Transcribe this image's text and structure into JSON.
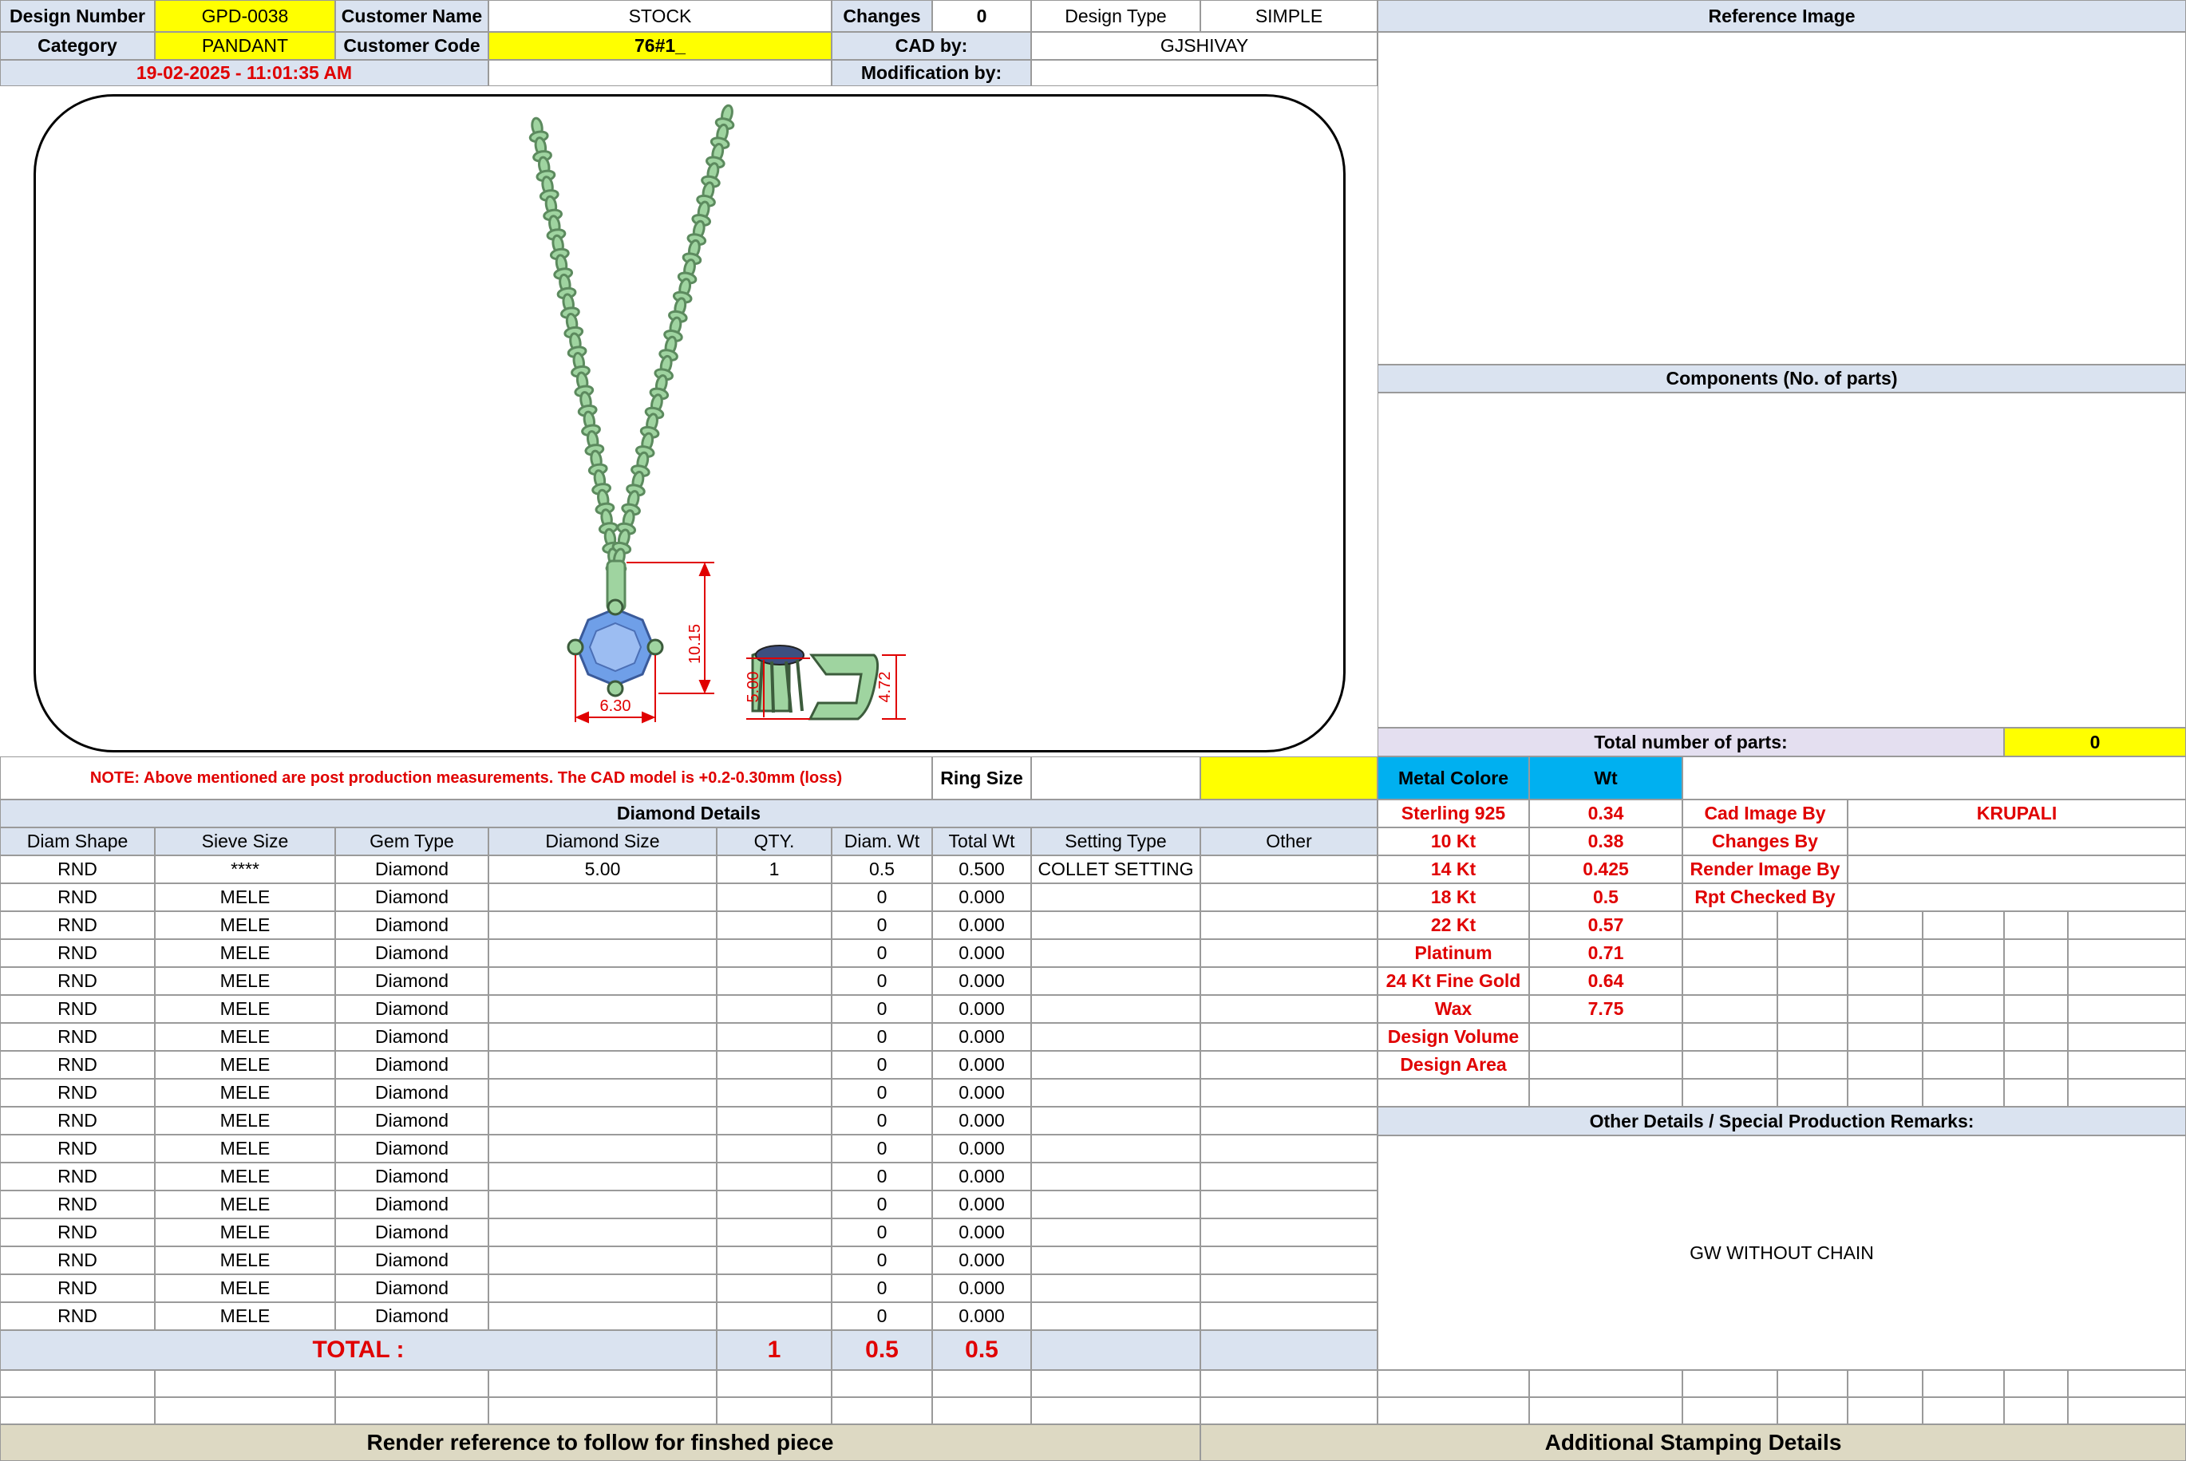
{
  "header": {
    "design_number_label": "Design Number",
    "design_number": "GPD-0038",
    "customer_name_label": "Customer Name",
    "customer_name": "STOCK",
    "changes_label": "Changes",
    "changes": "0",
    "design_type_label": "Design Type",
    "design_type": "SIMPLE",
    "reference_image_label": "Reference Image",
    "category_label": "Category",
    "category": "PANDANT",
    "customer_code_label": "Customer Code",
    "customer_code": "76#1_",
    "cad_by_label": "CAD by:",
    "cad_by": "GJSHIVAY",
    "timestamp": "19-02-2025 - 11:01:35 AM",
    "modification_by_label": "Modification by:"
  },
  "drawing": {
    "dims": [
      "10.15",
      "6.30",
      "5.00",
      "4.72"
    ]
  },
  "components_label": "Components (No. of parts)",
  "total_parts_label": "Total number of parts:",
  "total_parts": "0",
  "note": "NOTE: Above mentioned are post production measurements. The CAD model is +0.2-0.30mm (loss)",
  "ring_size_label": "Ring Size",
  "diamond": {
    "section_label": "Diamond Details",
    "columns": [
      "Diam Shape",
      "Sieve Size",
      "Gem Type",
      "Diamond Size",
      "QTY.",
      "Diam. Wt",
      "Total Wt",
      "Setting Type",
      "Other"
    ],
    "rows": [
      [
        "RND",
        "****",
        "Diamond",
        "5.00",
        "1",
        "0.5",
        "0.500",
        "COLLET SETTING",
        ""
      ],
      [
        "RND",
        "MELE",
        "Diamond",
        "",
        "",
        "0",
        "0.000",
        "",
        ""
      ],
      [
        "RND",
        "MELE",
        "Diamond",
        "",
        "",
        "0",
        "0.000",
        "",
        ""
      ],
      [
        "RND",
        "MELE",
        "Diamond",
        "",
        "",
        "0",
        "0.000",
        "",
        ""
      ],
      [
        "RND",
        "MELE",
        "Diamond",
        "",
        "",
        "0",
        "0.000",
        "",
        ""
      ],
      [
        "RND",
        "MELE",
        "Diamond",
        "",
        "",
        "0",
        "0.000",
        "",
        ""
      ],
      [
        "RND",
        "MELE",
        "Diamond",
        "",
        "",
        "0",
        "0.000",
        "",
        ""
      ],
      [
        "RND",
        "MELE",
        "Diamond",
        "",
        "",
        "0",
        "0.000",
        "",
        ""
      ],
      [
        "RND",
        "MELE",
        "Diamond",
        "",
        "",
        "0",
        "0.000",
        "",
        ""
      ],
      [
        "RND",
        "MELE",
        "Diamond",
        "",
        "",
        "0",
        "0.000",
        "",
        ""
      ],
      [
        "RND",
        "MELE",
        "Diamond",
        "",
        "",
        "0",
        "0.000",
        "",
        ""
      ],
      [
        "RND",
        "MELE",
        "Diamond",
        "",
        "",
        "0",
        "0.000",
        "",
        ""
      ],
      [
        "RND",
        "MELE",
        "Diamond",
        "",
        "",
        "0",
        "0.000",
        "",
        ""
      ],
      [
        "RND",
        "MELE",
        "Diamond",
        "",
        "",
        "0",
        "0.000",
        "",
        ""
      ],
      [
        "RND",
        "MELE",
        "Diamond",
        "",
        "",
        "0",
        "0.000",
        "",
        ""
      ],
      [
        "RND",
        "MELE",
        "Diamond",
        "",
        "",
        "0",
        "0.000",
        "",
        ""
      ],
      [
        "RND",
        "MELE",
        "Diamond",
        "",
        "",
        "0",
        "0.000",
        "",
        ""
      ]
    ],
    "total_label": "TOTAL :",
    "total_qty": "1",
    "total_diam_wt": "0.5",
    "total_wt": "0.5"
  },
  "metal": {
    "col_label": "Metal Colore",
    "wt_label": "Wt",
    "rows": [
      [
        "Sterling 925",
        "0.34"
      ],
      [
        "10 Kt",
        "0.38"
      ],
      [
        "14 Kt",
        "0.425"
      ],
      [
        "18 Kt",
        "0.5"
      ],
      [
        "22 Kt",
        "0.57"
      ],
      [
        "Platinum",
        "0.71"
      ],
      [
        "24 Kt Fine Gold",
        "0.64"
      ],
      [
        "Wax",
        "7.75"
      ],
      [
        "Design Volume",
        ""
      ],
      [
        "Design Area",
        ""
      ]
    ]
  },
  "credits": [
    [
      "Cad Image By",
      "KRUPALI"
    ],
    [
      "Changes By",
      ""
    ],
    [
      "Render Image By",
      ""
    ],
    [
      "Rpt Checked By",
      ""
    ]
  ],
  "other_details_label": "Other Details / Special Production Remarks:",
  "remarks": "GW WITHOUT CHAIN",
  "footer": {
    "render_reference": "Render reference to follow for finshed piece",
    "stamping": "Additional Stamping Details"
  },
  "colors": {
    "header_blue": "#dae3f0",
    "highlight_yellow": "#ffff00",
    "metal_cyan": "#00b0f0",
    "red_text": "#e00000",
    "metal_green": "#9fd4a0",
    "stone_blue": "#6f9fe8"
  }
}
